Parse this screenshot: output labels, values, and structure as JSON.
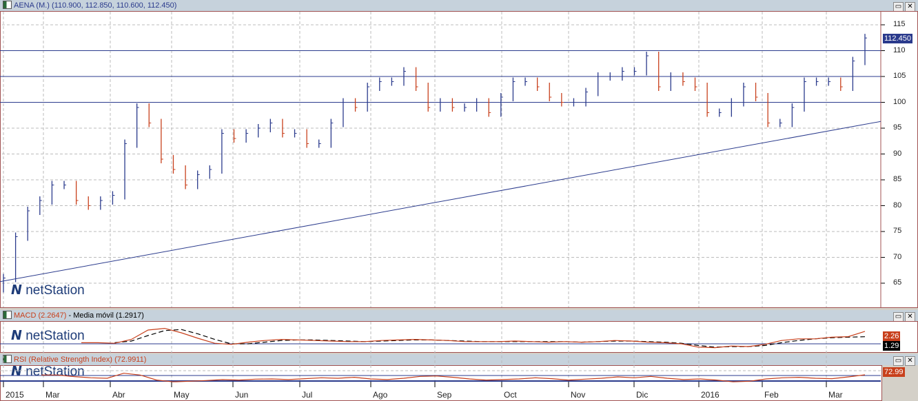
{
  "main": {
    "title": "AENA (M.) (110.900, 112.850, 110.600, 112.450)",
    "last_price": "112.450",
    "y_ticks": [
      "115",
      "110",
      "105",
      "100",
      "95",
      "90",
      "85",
      "80",
      "75",
      "70",
      "65"
    ],
    "logo": "netStation"
  },
  "macd": {
    "title_macd": "MACD (2.2647)",
    "sep": " - ",
    "title_ma": "Media móvil (1.2917)",
    "value_macd": "2.26",
    "value_ma": "1.29",
    "logo": "netStation"
  },
  "rsi": {
    "title": "RSI (Relative Strength Index) (72.9911)",
    "value": "72.99",
    "logo": "netStation"
  },
  "x_labels": [
    "2015",
    "Mar",
    "Abr",
    "May",
    "Jun",
    "Jul",
    "Ago",
    "Sep",
    "Oct",
    "Nov",
    "Dic",
    "2016",
    "Feb",
    "Mar"
  ],
  "colors": {
    "up": "#2a3a8c",
    "down": "#c8401c",
    "line": "#2a3a8c",
    "macd": "#c8401c",
    "ma": "#000000"
  },
  "chart_data": {
    "type": "bar",
    "title": "AENA (M.)",
    "ylim": [
      60,
      118
    ],
    "hlines": [
      110,
      105,
      100
    ],
    "trendline": [
      65.3,
      96.3
    ],
    "close": [
      66,
      74,
      79,
      81,
      84,
      84,
      81,
      80,
      81,
      82,
      92,
      99,
      96,
      89,
      87,
      84,
      86,
      87,
      94,
      93,
      94,
      95,
      96,
      94,
      94,
      92,
      92,
      96,
      100,
      99,
      103,
      104,
      104,
      106,
      103,
      99,
      100,
      99,
      99,
      100,
      98,
      101,
      104,
      104,
      103,
      101,
      100,
      100,
      102,
      105,
      105,
      106,
      106,
      109,
      103,
      105,
      104,
      103,
      98,
      98,
      100,
      103,
      101,
      96,
      96,
      99,
      104,
      104,
      104,
      103,
      108,
      112.45
    ],
    "macd": [
      0.2,
      0.2,
      0.1,
      0.8,
      2.5,
      2.8,
      2.0,
      1.0,
      0.1,
      -0.1,
      0.3,
      0.6,
      0.8,
      0.7,
      0.6,
      0.5,
      0.4,
      0.4,
      0.6,
      0.7,
      0.8,
      0.7,
      0.6,
      0.4,
      0.4,
      0.4,
      0.5,
      0.4,
      0.3,
      0.4,
      0.3,
      0.4,
      0.6,
      0.5,
      0.3,
      0.2,
      0.0,
      -0.6,
      -0.7,
      -0.4,
      -0.5,
      -0.1,
      0.6,
      0.9,
      0.9,
      1.2,
      1.3,
      2.26
    ],
    "ma": [
      null,
      null,
      0.2,
      0.5,
      1.5,
      2.4,
      2.6,
      1.8,
      0.8,
      0.0,
      0.0,
      0.3,
      0.6,
      0.7,
      0.7,
      0.6,
      0.5,
      0.4,
      0.5,
      0.6,
      0.7,
      0.7,
      0.6,
      0.5,
      0.4,
      0.4,
      0.4,
      0.4,
      0.4,
      0.4,
      0.3,
      0.4,
      0.5,
      0.5,
      0.4,
      0.3,
      0.1,
      -0.3,
      -0.6,
      -0.5,
      -0.5,
      -0.3,
      0.2,
      0.6,
      0.9,
      1.1,
      1.2,
      1.29
    ],
    "rsi": [
      72,
      72,
      65,
      60,
      58,
      80,
      72,
      50,
      42,
      45,
      48,
      52,
      50,
      54,
      55,
      52,
      56,
      60,
      58,
      62,
      55,
      52,
      58,
      66,
      68,
      62,
      55,
      50,
      52,
      55,
      60,
      56,
      50,
      54,
      58,
      64,
      60,
      66,
      58,
      52,
      55,
      50,
      42,
      45,
      55,
      60,
      62,
      58,
      56,
      64,
      72.99
    ]
  }
}
